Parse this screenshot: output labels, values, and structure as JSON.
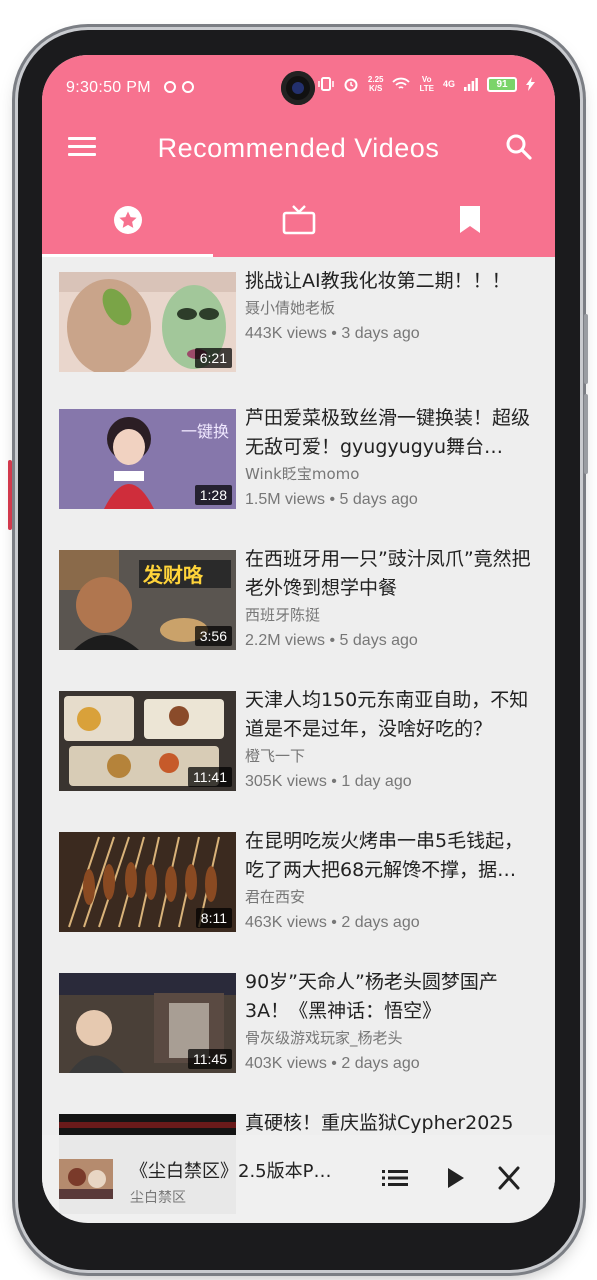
{
  "status": {
    "time": "9:30:50 PM",
    "net_speed_value": "2.25",
    "net_speed_unit": "K/S",
    "volte_top": "Vo",
    "volte_bottom": "LTE",
    "signal_label": "4G",
    "battery": "91"
  },
  "app": {
    "title": "Recommended Videos",
    "menu_icon": "menu-icon",
    "search_icon": "search-icon"
  },
  "tabs": [
    {
      "icon": "star-icon",
      "active": true
    },
    {
      "icon": "tv-icon",
      "active": false
    },
    {
      "icon": "bookmark-icon",
      "active": false
    }
  ],
  "colors": {
    "accent": "#f7728f",
    "background": "#eeeeee",
    "title_text": "#222222",
    "secondary_text": "#777777"
  },
  "videos": [
    {
      "title": "挑战让AI教我化妆第二期！！！",
      "channel": "聂小倩她老板",
      "views": "443K views",
      "age": "3 days ago",
      "duration": "6:21"
    },
    {
      "title": "芦田爱菜极致丝滑一键换装！超级无敌可爱！gyugyugyu舞台…",
      "channel": "Wink眨宝momo",
      "views": "1.5M views",
      "age": "5 days ago",
      "duration": "1:28"
    },
    {
      "title": "在西班牙用一只”豉汁凤爪”竟然把老外馋到想学中餐",
      "channel": "西班牙陈挺",
      "views": "2.2M views",
      "age": "5 days ago",
      "duration": "3:56"
    },
    {
      "title": "天津人均150元东南亚自助，不知道是不是过年，没啥好吃的？",
      "channel": "橙飞一下",
      "views": "305K views",
      "age": "1 day ago",
      "duration": "11:41"
    },
    {
      "title": "在昆明吃炭火烤串一串5毛钱起，吃了两大把68元解馋不撑，据…",
      "channel": "君在西安",
      "views": "463K views",
      "age": "2 days ago",
      "duration": "8:11"
    },
    {
      "title": "90岁”天命人”杨老头圆梦国产3A！《黑神话：悟空》",
      "channel": "骨灰级游戏玩家_杨老头",
      "views": "403K views",
      "age": "2 days ago",
      "duration": "11:45"
    },
    {
      "title": "真硬核！重庆监狱Cypher2025",
      "channel": "",
      "views": "",
      "age": "",
      "duration": ""
    }
  ],
  "thumb_overlays": {
    "v2": "一键换",
    "v3": "发财咯"
  },
  "mini_player": {
    "title": "《尘白禁区》2.5版本P…",
    "subtitle": "尘白禁区",
    "queue_icon": "queue-icon",
    "play_icon": "play-icon",
    "close_icon": "close-icon"
  },
  "separator": "•"
}
